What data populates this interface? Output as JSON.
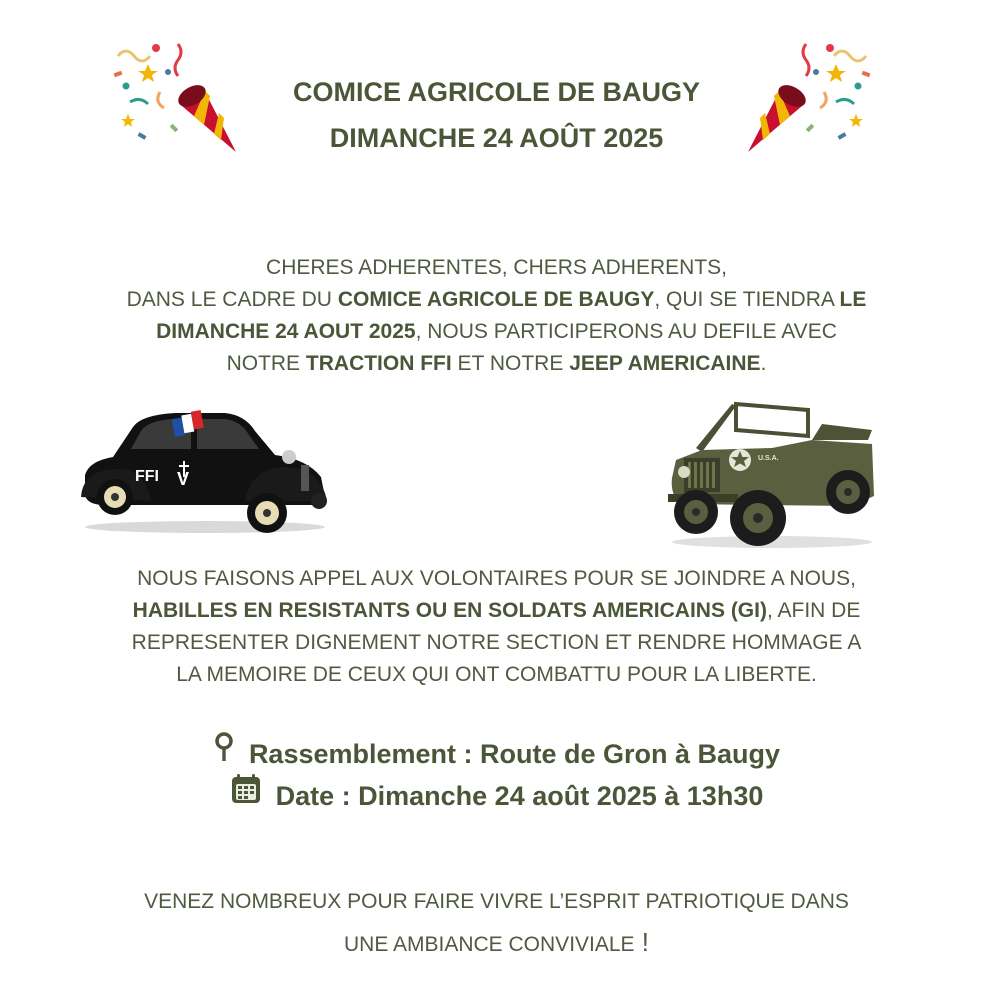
{
  "header": {
    "title_line1": "COMICE AGRICOLE DE BAUGY",
    "title_line2": "DIMANCHE 24 AOÛT 2025",
    "left_icon": "party-popper-icon",
    "right_icon": "party-popper-icon"
  },
  "intro": {
    "l1": "CHERES ADHERENTES, CHERS ADHERENTS,",
    "l2a": "DANS LE CADRE DU ",
    "l2b": "COMICE AGRICOLE DE BAUGY",
    "l2c": ", QUI SE TIENDRA ",
    "l2d": "LE",
    "l3a": "DIMANCHE 24 AOUT 2025",
    "l3b": ", NOUS PARTICIPERONS AU DEFILE AVEC",
    "l4a": "NOTRE ",
    "l4b": "TRACTION FFI",
    "l4c": " ET NOTRE ",
    "l4d": "JEEP AMERICAINE",
    "l4e": "."
  },
  "appeal": {
    "l1": "NOUS FAISONS APPEL AUX VOLONTAIRES POUR SE JOINDRE A NOUS,",
    "l2a": "HABILLES EN RESISTANTS OU EN SOLDATS AMERICAINS (GI)",
    "l2b": ", AFIN DE",
    "l3": "REPRESENTER DIGNEMENT NOTRE SECTION ET RENDRE HOMMAGE A",
    "l4": "LA MEMOIRE DE CEUX QUI ONT COMBATTU POUR LA LIBERTE."
  },
  "details": {
    "location": "Rassemblement : Route de Gron à Baugy",
    "date": "Date : Dimanche 24 août 2025 à 13h30",
    "location_icon": "map-pin-icon",
    "date_icon": "calendar-icon"
  },
  "closing": {
    "l1": "VENEZ NOMBREUX POUR FAIRE VIVRE L’ESPRIT PATRIOTIQUE DANS",
    "l2": "UNE AMBIANCE CONVIVIALE",
    "l2_end": " !"
  },
  "images": {
    "left_car_text": "FFI",
    "jeep_text": "U.S.A."
  },
  "colors": {
    "text": "#4f5a40",
    "title": "#4a5637",
    "popper_red": "#c8102e",
    "popper_gold": "#f2b705"
  }
}
